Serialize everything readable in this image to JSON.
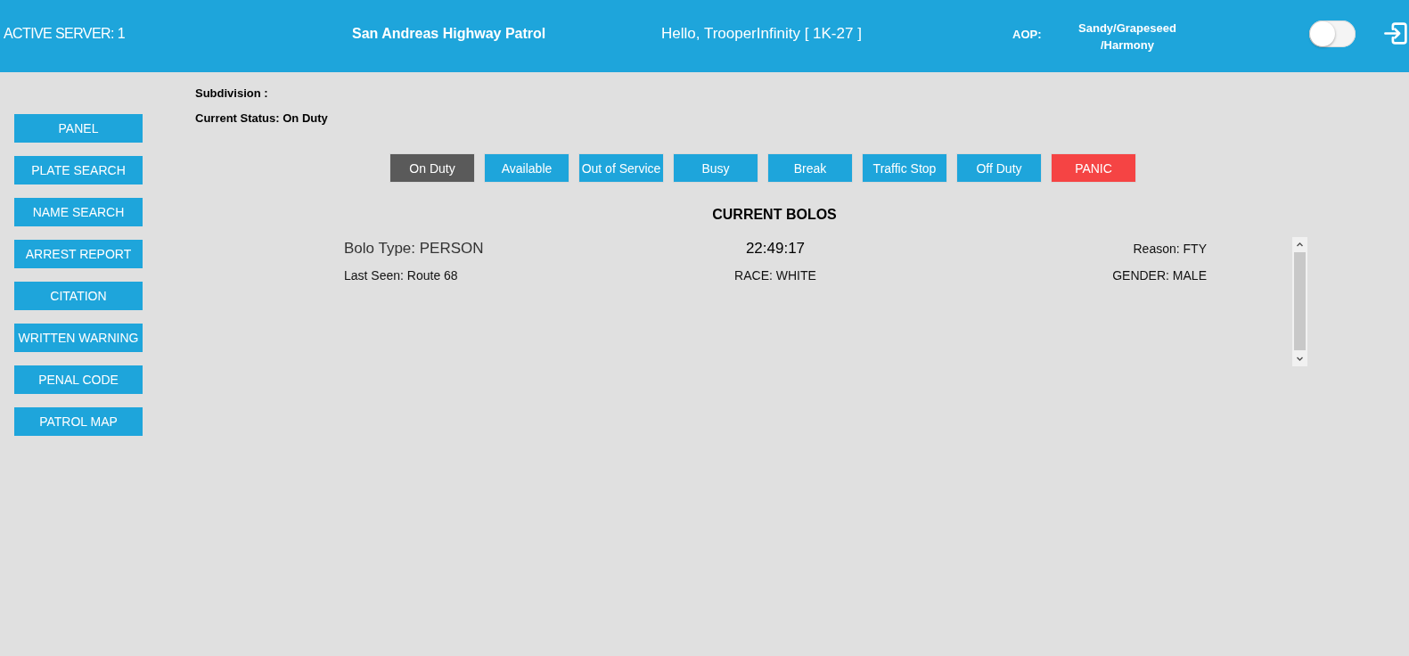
{
  "header": {
    "server": "ACTIVE SERVER: 1",
    "agency": "San Andreas Highway Patrol",
    "greeting": "Hello, TrooperInfinity [ 1K-27 ]",
    "aop_label": "AOP:",
    "aop_lines": [
      "Sandy/Grapeseed",
      "/Harmony"
    ],
    "toggle": {
      "on": false
    }
  },
  "sidebar": {
    "items": [
      "PANEL",
      "PLATE SEARCH",
      "NAME SEARCH",
      "ARREST REPORT",
      "CITATION",
      "WRITTEN WARNING",
      "PENAL CODE",
      "PATROL MAP"
    ]
  },
  "subdivision": "Subdivision :",
  "current_status": "Current Status: On Duty",
  "status_buttons": [
    {
      "label": "On Duty",
      "kind": "status",
      "selected": true
    },
    {
      "label": "Available",
      "kind": "status",
      "selected": false
    },
    {
      "label": "Out of Service",
      "kind": "status",
      "selected": false
    },
    {
      "label": "Busy",
      "kind": "status",
      "selected": false
    },
    {
      "label": "Break",
      "kind": "status",
      "selected": false
    },
    {
      "label": "Traffic Stop",
      "kind": "status",
      "selected": false
    },
    {
      "label": "Off Duty",
      "kind": "status",
      "selected": false
    },
    {
      "label": "PANIC",
      "kind": "panic",
      "selected": false
    }
  ],
  "bolos": {
    "title": "CURRENT BOLOS",
    "items": [
      {
        "type": "Bolo Type: PERSON",
        "time": "22:49:17",
        "reason": "Reason: FTY",
        "last_seen": "Last Seen: Route 68",
        "race": "RACE: WHITE",
        "gender": "GENDER: MALE"
      }
    ]
  }
}
